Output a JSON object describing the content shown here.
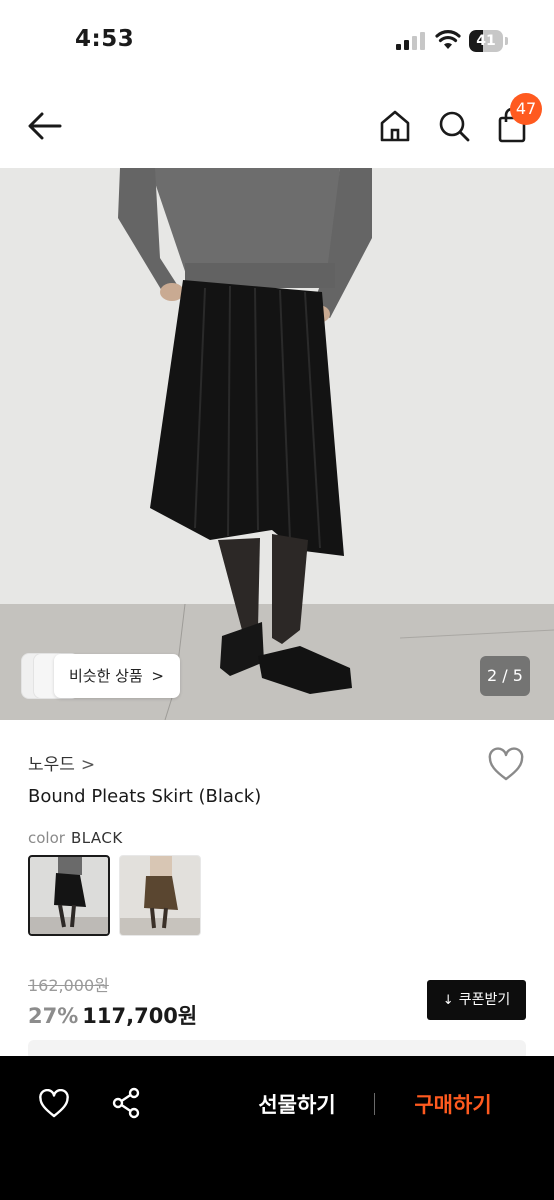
{
  "status_bar": {
    "time": "4:53",
    "battery_percent": "41",
    "battery_level": 0.41,
    "icons": [
      "signal-icon",
      "wifi-icon",
      "battery-icon"
    ]
  },
  "nav": {
    "icons": [
      "back-arrow-icon",
      "home-icon",
      "search-icon",
      "shopping-bag-icon"
    ],
    "cart_count": "47",
    "badge_color": "#ff5a1f"
  },
  "hero": {
    "similar_label": "비슷한 상품",
    "similar_chevron": ">",
    "page_indicator": "2 / 5"
  },
  "product": {
    "brand": "노우드",
    "brand_chevron": ">",
    "name": "Bound Pleats Skirt (Black)",
    "color_label": "color",
    "color_value": "BLACK",
    "swatches": [
      "black-skirt-swatch",
      "brown-skirt-swatch"
    ],
    "original_price": "162,000원",
    "discount": "27%",
    "price": "117,700원",
    "coupon_icon": "↓",
    "coupon_label": "쿠폰받기"
  },
  "bottom_bar": {
    "icons": [
      "heart-icon",
      "share-icon"
    ],
    "gift_label": "선물하기",
    "buy_label": "구매하기",
    "accent_color": "#ff5a1f"
  }
}
